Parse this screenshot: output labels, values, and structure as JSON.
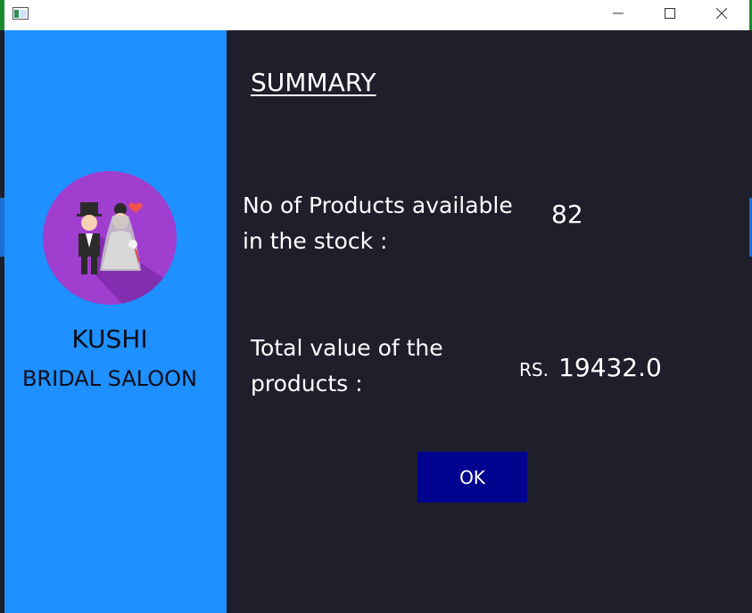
{
  "window": {
    "controls": {
      "minimize": "minimize-icon",
      "maximize": "maximize-icon",
      "close": "close-icon"
    }
  },
  "sidebar": {
    "brand_line1": "KUSHI",
    "brand_line2": "BRIDAL SALOON",
    "logo": "couple-logo-icon"
  },
  "summary": {
    "heading": "SUMMARY",
    "products_label": "No of Products available in the stock :",
    "products_value": "82",
    "total_label": "Total value of the products   :",
    "currency": "RS.",
    "total_value": "19432.0",
    "ok_label": "OK"
  },
  "colors": {
    "sidebar": "#1e90ff",
    "content_bg": "#1f1e2b",
    "button": "#02038f"
  }
}
